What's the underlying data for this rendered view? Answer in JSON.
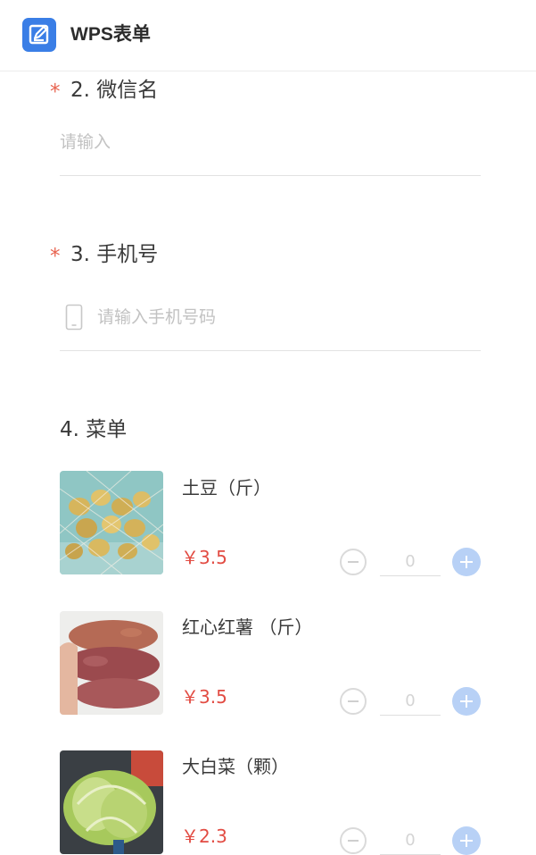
{
  "header": {
    "title": "WPS表单",
    "logo_icon": "form-edit-icon"
  },
  "questions": {
    "wechat": {
      "required_mark": "*",
      "title": "2. 微信名",
      "placeholder": "请输入"
    },
    "phone": {
      "required_mark": "*",
      "title": "3. 手机号",
      "placeholder": "请输入手机号码",
      "icon": "mobile-phone-icon"
    },
    "menu": {
      "title": "4. 菜单",
      "items": [
        {
          "name": "土豆（斤）",
          "price": "￥3.5",
          "quantity": "0",
          "image": "potatoes-photo"
        },
        {
          "name": "红心红薯 （斤）",
          "price": "￥3.5",
          "quantity": "0",
          "image": "sweet-potatoes-photo"
        },
        {
          "name": "大白菜（颗）",
          "price": "￥2.3",
          "quantity": "0",
          "image": "napa-cabbage-photo"
        }
      ]
    }
  },
  "colors": {
    "brand": "#3a7ee6",
    "required": "#e8634f",
    "price": "#e24c43",
    "plus_button": "#b8d1f6"
  }
}
